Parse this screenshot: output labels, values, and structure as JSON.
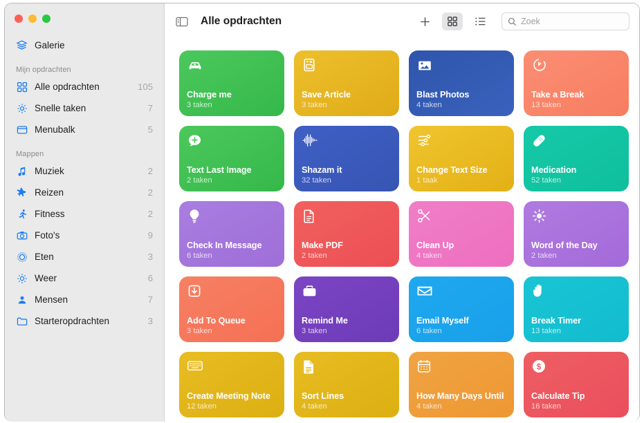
{
  "window": {
    "traffic_lights": [
      "close",
      "minimize",
      "zoom"
    ]
  },
  "sidebar": {
    "gallery": {
      "label": "Galerie",
      "icon": "gallery-stack-icon"
    },
    "sections": [
      {
        "title": "Mijn opdrachten",
        "items": [
          {
            "label": "Alle opdrachten",
            "count": "105",
            "icon": "grid-icon"
          },
          {
            "label": "Snelle taken",
            "count": "7",
            "icon": "gear-icon"
          },
          {
            "label": "Menubalk",
            "count": "5",
            "icon": "menubar-icon"
          }
        ]
      },
      {
        "title": "Mappen",
        "items": [
          {
            "label": "Muziek",
            "count": "2",
            "icon": "music-note-icon"
          },
          {
            "label": "Reizen",
            "count": "2",
            "icon": "airplane-icon"
          },
          {
            "label": "Fitness",
            "count": "2",
            "icon": "runner-icon"
          },
          {
            "label": "Foto's",
            "count": "9",
            "icon": "camera-icon"
          },
          {
            "label": "Eten",
            "count": "3",
            "icon": "fork-circle-icon"
          },
          {
            "label": "Weer",
            "count": "6",
            "icon": "sun-icon"
          },
          {
            "label": "Mensen",
            "count": "7",
            "icon": "person-icon"
          },
          {
            "label": "Starteropdrachten",
            "count": "3",
            "icon": "folder-icon"
          }
        ]
      }
    ]
  },
  "toolbar": {
    "sidebar_toggle_icon": "sidebar-toggle-icon",
    "title": "Alle opdrachten",
    "add_label": "+",
    "grid_view_icon": "grid-view-icon",
    "list_view_icon": "list-view-icon",
    "search": {
      "placeholder": "Zoek",
      "value": "",
      "icon": "search-icon"
    }
  },
  "shortcuts": [
    {
      "name": "Charge me",
      "count": "3 taken",
      "icon": "car-bolt-icon",
      "c1": "#4cc85c",
      "c2": "#35b84a"
    },
    {
      "name": "Save Article",
      "count": "3 taken",
      "icon": "article-icon",
      "c1": "#edc02c",
      "c2": "#e0ab18"
    },
    {
      "name": "Blast Photos",
      "count": "4 taken",
      "icon": "photo-icon",
      "c1": "#2f55ab",
      "c2": "#3a62bd"
    },
    {
      "name": "Take a Break",
      "count": "13 taken",
      "icon": "stopwatch-icon",
      "c1": "#fa8e74",
      "c2": "#f87d60"
    },
    {
      "name": "Text Last Image",
      "count": "2 taken",
      "icon": "message-plus-icon",
      "c1": "#4cc85c",
      "c2": "#35b84a"
    },
    {
      "name": "Shazam it",
      "count": "32 taken",
      "icon": "waveform-icon",
      "c1": "#3f5fc4",
      "c2": "#3655b4"
    },
    {
      "name": "Change Text Size",
      "count": "1 taak",
      "icon": "sliders-icon",
      "c1": "#f0c52e",
      "c2": "#e3b016"
    },
    {
      "name": "Medication",
      "count": "52 taken",
      "icon": "pill-icon",
      "c1": "#16c9a8",
      "c2": "#0fbf9c"
    },
    {
      "name": "Check In Message",
      "count": "6 taken",
      "icon": "lightbulb-icon",
      "c1": "#a97de0",
      "c2": "#9e6fd8"
    },
    {
      "name": "Make PDF",
      "count": "2 taken",
      "icon": "document-icon",
      "c1": "#f1605f",
      "c2": "#ec4f54"
    },
    {
      "name": "Clean Up",
      "count": "4 taken",
      "icon": "scissors-icon",
      "c1": "#f07ec8",
      "c2": "#ed6fbf"
    },
    {
      "name": "Word of the Day",
      "count": "2 taken",
      "icon": "sun-rays-icon",
      "c1": "#b07be0",
      "c2": "#a36ad9"
    },
    {
      "name": "Add To Queue",
      "count": "3 taken",
      "icon": "tray-down-icon",
      "c1": "#f78063",
      "c2": "#f57055"
    },
    {
      "name": "Remind Me",
      "count": "3 taken",
      "icon": "briefcase-icon",
      "c1": "#7b45c4",
      "c2": "#6d3bb8"
    },
    {
      "name": "Email Myself",
      "count": "6 taken",
      "icon": "envelope-icon",
      "c1": "#1fa8ef",
      "c2": "#18a0ea"
    },
    {
      "name": "Break Timer",
      "count": "13 taken",
      "icon": "hand-raised-icon",
      "c1": "#19c5d4",
      "c2": "#12bccf"
    },
    {
      "name": "Create Meeting Note",
      "count": "12 taken",
      "icon": "keyboard-icon",
      "c1": "#e8bd23",
      "c2": "#dcaf12"
    },
    {
      "name": "Sort Lines",
      "count": "4 taken",
      "icon": "doc-lines-icon",
      "c1": "#e8bd23",
      "c2": "#dcaf12"
    },
    {
      "name": "How Many Days Until",
      "count": "4 taken",
      "icon": "calendar-icon",
      "c1": "#f0a442",
      "c2": "#ee9733"
    },
    {
      "name": "Calculate Tip",
      "count": "16 taken",
      "icon": "dollar-circle-icon",
      "c1": "#ee5e63",
      "c2": "#ea4f5c"
    }
  ]
}
